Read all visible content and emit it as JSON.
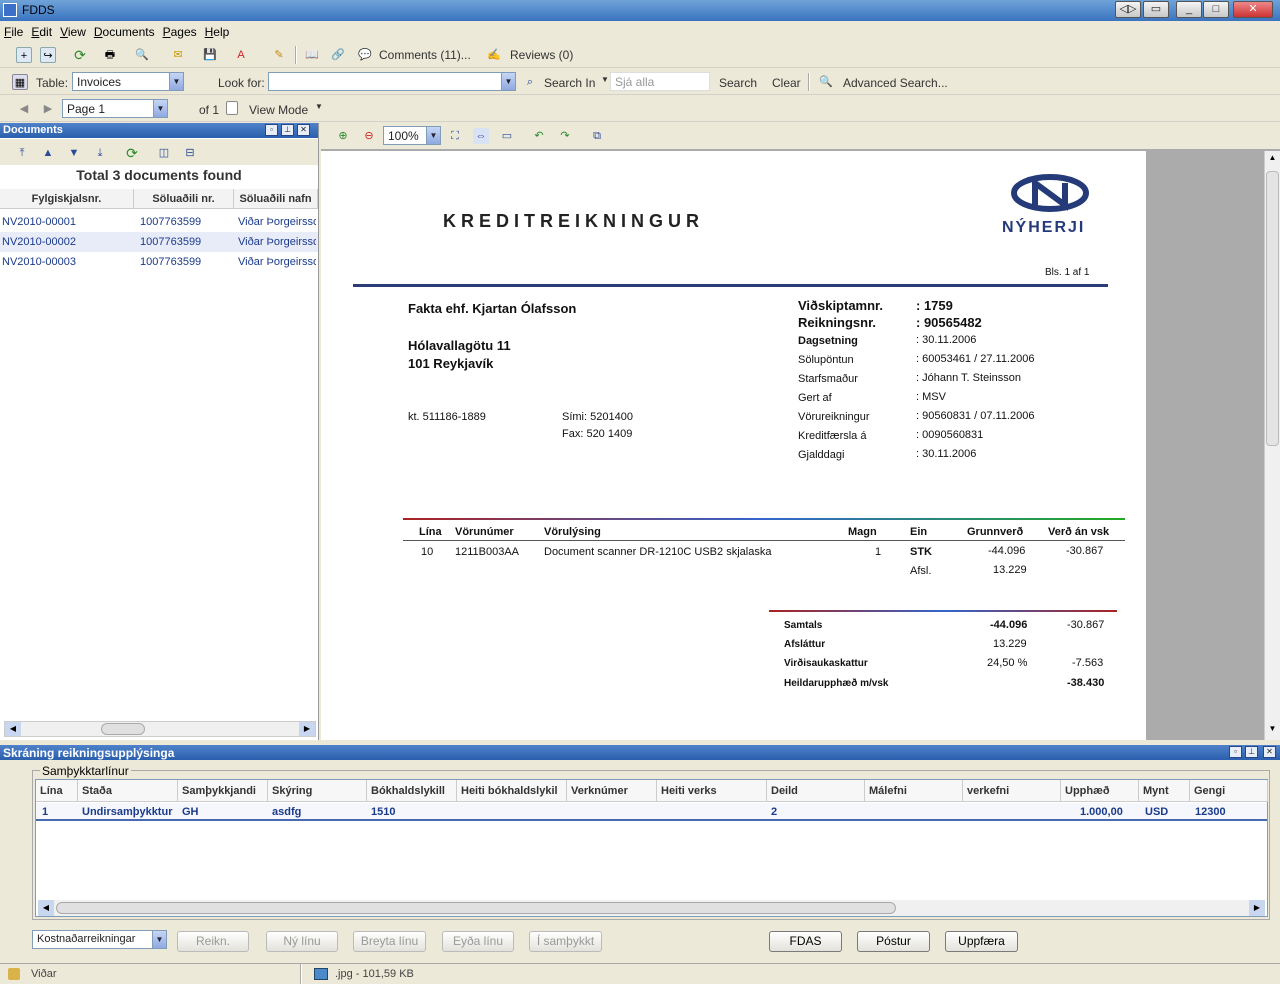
{
  "window": {
    "title": "FDDS"
  },
  "menu": [
    "File",
    "Edit",
    "View",
    "Documents",
    "Pages",
    "Help"
  ],
  "toolbar1": {
    "comments": "Comments (11)...",
    "reviews": "Reviews (0)"
  },
  "toolbar2": {
    "table_label": "Table:",
    "table_value": "Invoices",
    "look_for_label": "Look for:",
    "look_for_value": "",
    "search_in": "Search In",
    "see_all_placeholder": "Sjá alla",
    "search": "Search",
    "clear": "Clear",
    "advanced": "Advanced Search..."
  },
  "toolbar3": {
    "page_value": "Page 1",
    "of": "of 1",
    "view_mode": "View Mode"
  },
  "documents": {
    "title": "Documents",
    "total": "Total 3 documents found",
    "columns": [
      "Fylgiskjalsnr.",
      "Söluaðili nr.",
      "Söluaðili nafn"
    ],
    "rows": [
      [
        "NV2010-00001",
        "1007763599",
        "Viðar Þorgeirsson"
      ],
      [
        "NV2010-00002",
        "1007763599",
        "Viðar Þorgeirsson"
      ],
      [
        "NV2010-00003",
        "1007763599",
        "Viðar Þorgeirsson"
      ]
    ]
  },
  "viewer": {
    "zoom": "100%"
  },
  "invoice": {
    "heading": "KREDITREIKNINGUR",
    "logo": "NÝHERJI",
    "page": "Bls. 1 af 1",
    "customer": "Fakta ehf. Kjartan Ólafsson",
    "street": "Hólavallagötu 11",
    "city": "101  Reykjavík",
    "kt": "kt. 511186-1889",
    "phone": "Sími: 5201400",
    "fax": "Fax: 520 1409",
    "meta": [
      [
        "Viðskiptamnr.",
        ": 1759"
      ],
      [
        "Reikningsnr.",
        ": 90565482"
      ],
      [
        "Dagsetning",
        ": 30.11.2006"
      ],
      [
        "Sölupöntun",
        ": 60053461 / 27.11.2006"
      ],
      [
        "Starfsmaður",
        ": Jóhann T. Steinsson"
      ],
      [
        "Gert af",
        ": MSV"
      ],
      [
        "Vörureikningur",
        ": 90560831 /   07.11.2006"
      ],
      [
        "Kreditfærsla á",
        ": 0090560831"
      ],
      [
        "Gjalddagi",
        ": 30.11.2006"
      ]
    ],
    "line_headers": [
      "Lína",
      "Vörunúmer",
      "Vörulýsing",
      "Magn",
      "Ein",
      "Grunnverð",
      "Verð án vsk"
    ],
    "line": [
      "10",
      "1211B003AA",
      "Document scanner DR-1210C USB2 skjalaska",
      "1",
      "STK",
      "-44.096",
      "-30.867"
    ],
    "afsl_label": "Afsl.",
    "afsl_value": "13.229",
    "totals": [
      [
        "Samtals",
        "-44.096",
        "-30.867"
      ],
      [
        "Afsláttur",
        "13.229",
        ""
      ],
      [
        "Virðisaukaskattur",
        "24,50 %",
        "-7.563"
      ],
      [
        "Heildarupphæð m/vsk",
        "",
        "-38.430"
      ]
    ]
  },
  "registration": {
    "title": "Skráning reikningsupplýsinga",
    "group": "Samþykktarlínur",
    "columns": [
      "Lína",
      "Staða",
      "Samþykkjandi",
      "Skýring",
      "Bókhaldslykill",
      "Heiti bókhaldslykil",
      "Verknúmer",
      "Heiti verks",
      "Deild",
      "Málefni",
      "verkefni",
      "Upphæð",
      "Mynt",
      "Gengi"
    ],
    "row": [
      "1",
      "Undirsamþykktur",
      "GH",
      "asdfg",
      "1510",
      "",
      "",
      "",
      "2",
      "",
      "",
      "1.000,00",
      "USD",
      "12300"
    ]
  },
  "buttons": {
    "type_value": "Kostnaðarreikningar",
    "reikn": "Reikn.",
    "ny_lina": "Ný línu",
    "breyta": "Breyta línu",
    "eyda": "Eyða línu",
    "samthykkt": "Í samþykkt",
    "fdas": "FDAS",
    "postur": "Póstur",
    "uppfaera": "Uppfæra"
  },
  "status": {
    "user": "Viðar",
    "file": ".jpg - 101,59 KB"
  }
}
